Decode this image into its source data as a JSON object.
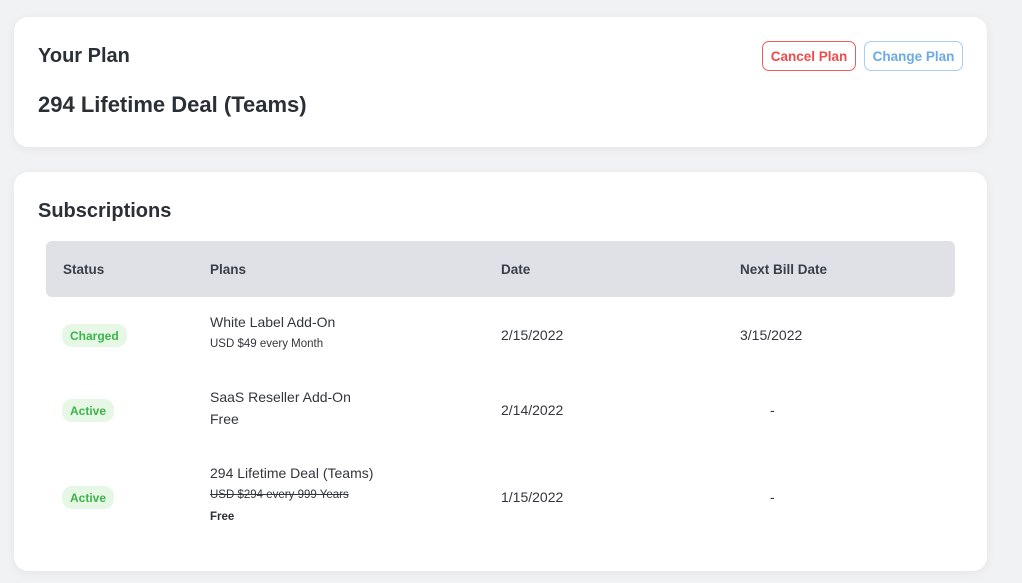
{
  "plan": {
    "title": "Your Plan",
    "name": "294 Lifetime Deal (Teams)",
    "cancel_label": "Cancel Plan",
    "change_label": "Change Plan"
  },
  "subscriptions": {
    "title": "Subscriptions",
    "columns": [
      "Status",
      "Plans",
      "Date",
      "Next Bill Date"
    ],
    "rows": [
      {
        "status": "Charged",
        "plan": "White Label Add-On",
        "price": "USD $49 every Month",
        "date": "2/15/2022",
        "next_bill": "3/15/2022"
      },
      {
        "status": "Active",
        "plan": "SaaS Reseller Add-On",
        "price": "Free",
        "date": "2/14/2022",
        "next_bill": "-"
      },
      {
        "status": "Active",
        "plan": "294 Lifetime Deal (Teams)",
        "original_price": "USD $294 every 999 Years",
        "price": "Free",
        "date": "1/15/2022",
        "next_bill": "-"
      }
    ]
  },
  "colors": {
    "background": "#f1f2f4",
    "cancel": "#ef4b4b",
    "change": "#6aaae8",
    "badge_bg": "#e6f7e6",
    "badge_text": "#3cb44b",
    "table_header": "#dfe1e6"
  }
}
